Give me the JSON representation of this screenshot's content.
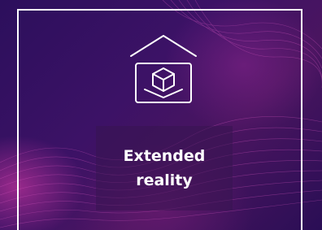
{
  "card": {
    "title_line1": "Extended",
    "title_line2": "reality",
    "icon": "xr-cube-box-icon"
  }
}
